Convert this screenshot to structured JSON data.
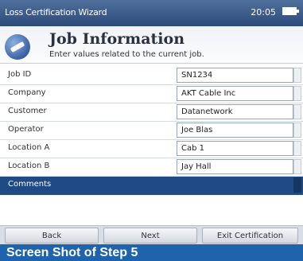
{
  "window": {
    "title": "Loss Certification Wizard",
    "time": "20:05"
  },
  "header": {
    "title": "Job Information",
    "subtitle": "Enter values related to the current job."
  },
  "fields": [
    {
      "label": "Job ID",
      "value": "SN1234"
    },
    {
      "label": "Company",
      "value": "AKT Cable Inc"
    },
    {
      "label": "Customer",
      "value": "Datanetwork"
    },
    {
      "label": "Operator",
      "value": "Joe Blas"
    },
    {
      "label": "Location A",
      "value": "Cab 1"
    },
    {
      "label": "Location B",
      "value": "Jay Hall"
    },
    {
      "label": "Comments",
      "value": ""
    }
  ],
  "buttons": {
    "back": "Back",
    "next": "Next",
    "exit": "Exit Certification"
  },
  "caption": "Screen Shot of Step 5"
}
